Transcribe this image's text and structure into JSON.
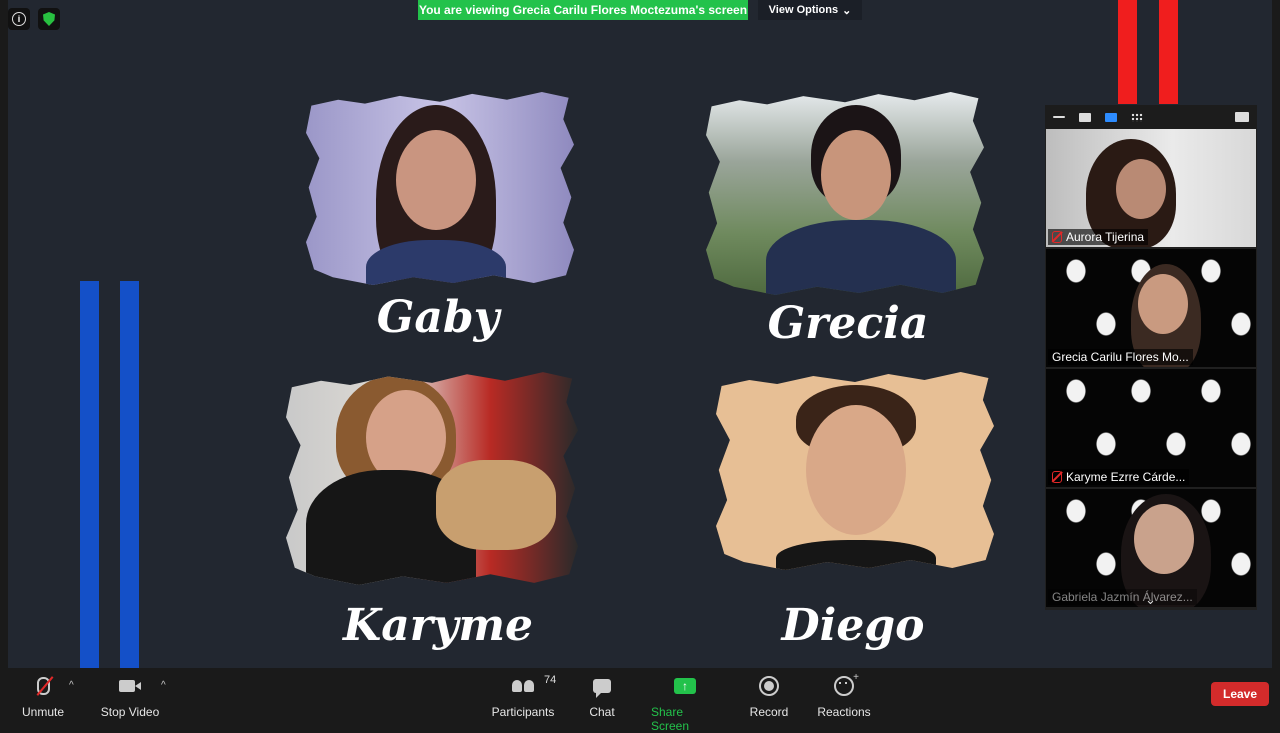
{
  "banner": {
    "text": "You are viewing Grecia Carilu Flores Moctezuma's screen"
  },
  "view_options": {
    "label": "View Options",
    "chevron": "⌄"
  },
  "top_icons": {
    "info": "i"
  },
  "slide": {
    "names": [
      "Gaby",
      "Grecia",
      "Karyme",
      "Diego"
    ]
  },
  "gallery": {
    "participants": [
      {
        "name": "Aurora Tijerina",
        "muted": true
      },
      {
        "name": "Grecia Carilu Flores Mo...",
        "muted": false
      },
      {
        "name": "Karyme Ezrre Cárde...",
        "muted": true
      },
      {
        "name": "Gabriela Jazmín Álvarez...",
        "muted": false
      }
    ],
    "scroll_chevron": "⌄"
  },
  "toolbar": {
    "unmute": "Unmute",
    "stop_video": "Stop Video",
    "participants": "Participants",
    "participants_count": "74",
    "chat": "Chat",
    "share_screen": "Share Screen",
    "share_arrow": "↑",
    "record": "Record",
    "reactions": "Reactions",
    "reactions_plus": "+",
    "caret": "^",
    "leave": "Leave"
  },
  "colors": {
    "banner_green": "#23c24b",
    "leave_red": "#d32b2b",
    "stripe_blue": "#1450c8",
    "stripe_red": "#f01e1e",
    "slide_bg": "#222730"
  }
}
